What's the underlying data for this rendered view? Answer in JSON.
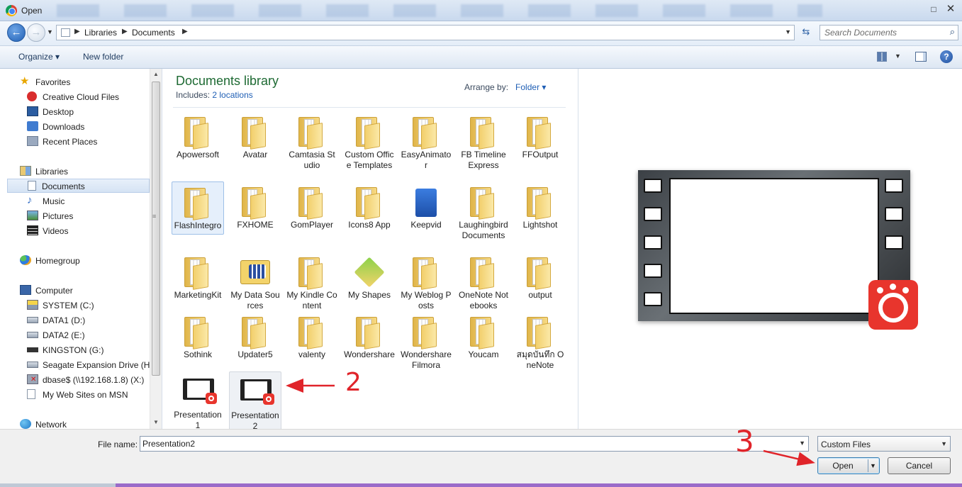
{
  "window": {
    "title": "Open",
    "close_glyph": "✕",
    "maximize_glyph": "□"
  },
  "address": {
    "breadcrumbs": [
      "Libraries",
      "Documents"
    ],
    "search_placeholder": "Search Documents"
  },
  "toolbar": {
    "organize": "Organize ▾",
    "new_folder": "New folder"
  },
  "nav": {
    "favorites": {
      "label": "Favorites",
      "items": [
        "Creative Cloud Files",
        "Desktop",
        "Downloads",
        "Recent Places"
      ]
    },
    "libraries": {
      "label": "Libraries",
      "items": [
        "Documents",
        "Music",
        "Pictures",
        "Videos"
      ],
      "selected": "Documents"
    },
    "homegroup": "Homegroup",
    "computer": {
      "label": "Computer",
      "items": [
        "SYSTEM (C:)",
        "DATA1 (D:)",
        "DATA2 (E:)",
        "KINGSTON (G:)",
        "Seagate Expansion Drive (H:)",
        "dbase$ (\\\\192.168.1.8) (X:)",
        "My Web Sites on MSN"
      ]
    },
    "network": "Network"
  },
  "library": {
    "title": "Documents library",
    "includes_label": "Includes:",
    "includes_link": "2 locations",
    "arrange_label": "Arrange by:",
    "arrange_value": "Folder ▾"
  },
  "items": [
    {
      "name": "Apowersoft",
      "kind": "folder"
    },
    {
      "name": "Avatar",
      "kind": "folder"
    },
    {
      "name": "Camtasia Studio",
      "kind": "folder"
    },
    {
      "name": "Custom Office Templates",
      "kind": "folder"
    },
    {
      "name": "EasyAnimator",
      "kind": "folder"
    },
    {
      "name": "FB Timeline Express",
      "kind": "folder"
    },
    {
      "name": "FFOutput",
      "kind": "folder"
    },
    {
      "name": "FlashIntegro",
      "kind": "folder",
      "state": "selected"
    },
    {
      "name": "FXHOME",
      "kind": "folder"
    },
    {
      "name": "GomPlayer",
      "kind": "folder"
    },
    {
      "name": "Icons8 App",
      "kind": "folder"
    },
    {
      "name": "Keepvid",
      "kind": "app-keepvid"
    },
    {
      "name": "Laughingbird Documents",
      "kind": "folder"
    },
    {
      "name": "Lightshot",
      "kind": "folder"
    },
    {
      "name": "MarketingKit",
      "kind": "folder"
    },
    {
      "name": "My Data Sources",
      "kind": "app-datasources"
    },
    {
      "name": "My Kindle Content",
      "kind": "folder"
    },
    {
      "name": "My Shapes",
      "kind": "app-shapes"
    },
    {
      "name": "My Weblog Posts",
      "kind": "folder"
    },
    {
      "name": "OneNote Notebooks",
      "kind": "folder"
    },
    {
      "name": "output",
      "kind": "folder"
    },
    {
      "name": "Sothink",
      "kind": "folder"
    },
    {
      "name": "Updater5",
      "kind": "folder"
    },
    {
      "name": "valenty",
      "kind": "folder"
    },
    {
      "name": "Wondershare",
      "kind": "folder"
    },
    {
      "name": "Wondershare Filmora",
      "kind": "folder"
    },
    {
      "name": "Youcam",
      "kind": "folder"
    },
    {
      "name": "สมุดบันทึก OneNote",
      "kind": "folder"
    },
    {
      "name": "Presentation1",
      "kind": "video"
    },
    {
      "name": "Presentation2",
      "kind": "video",
      "state": "hovered"
    }
  ],
  "footer": {
    "file_name_label": "File name:",
    "file_name_value": "Presentation2",
    "filter_value": "Custom Files",
    "open_label": "Open",
    "cancel_label": "Cancel"
  },
  "annotations": {
    "step2": "2",
    "step3": "3",
    "color": "#e0242a"
  }
}
